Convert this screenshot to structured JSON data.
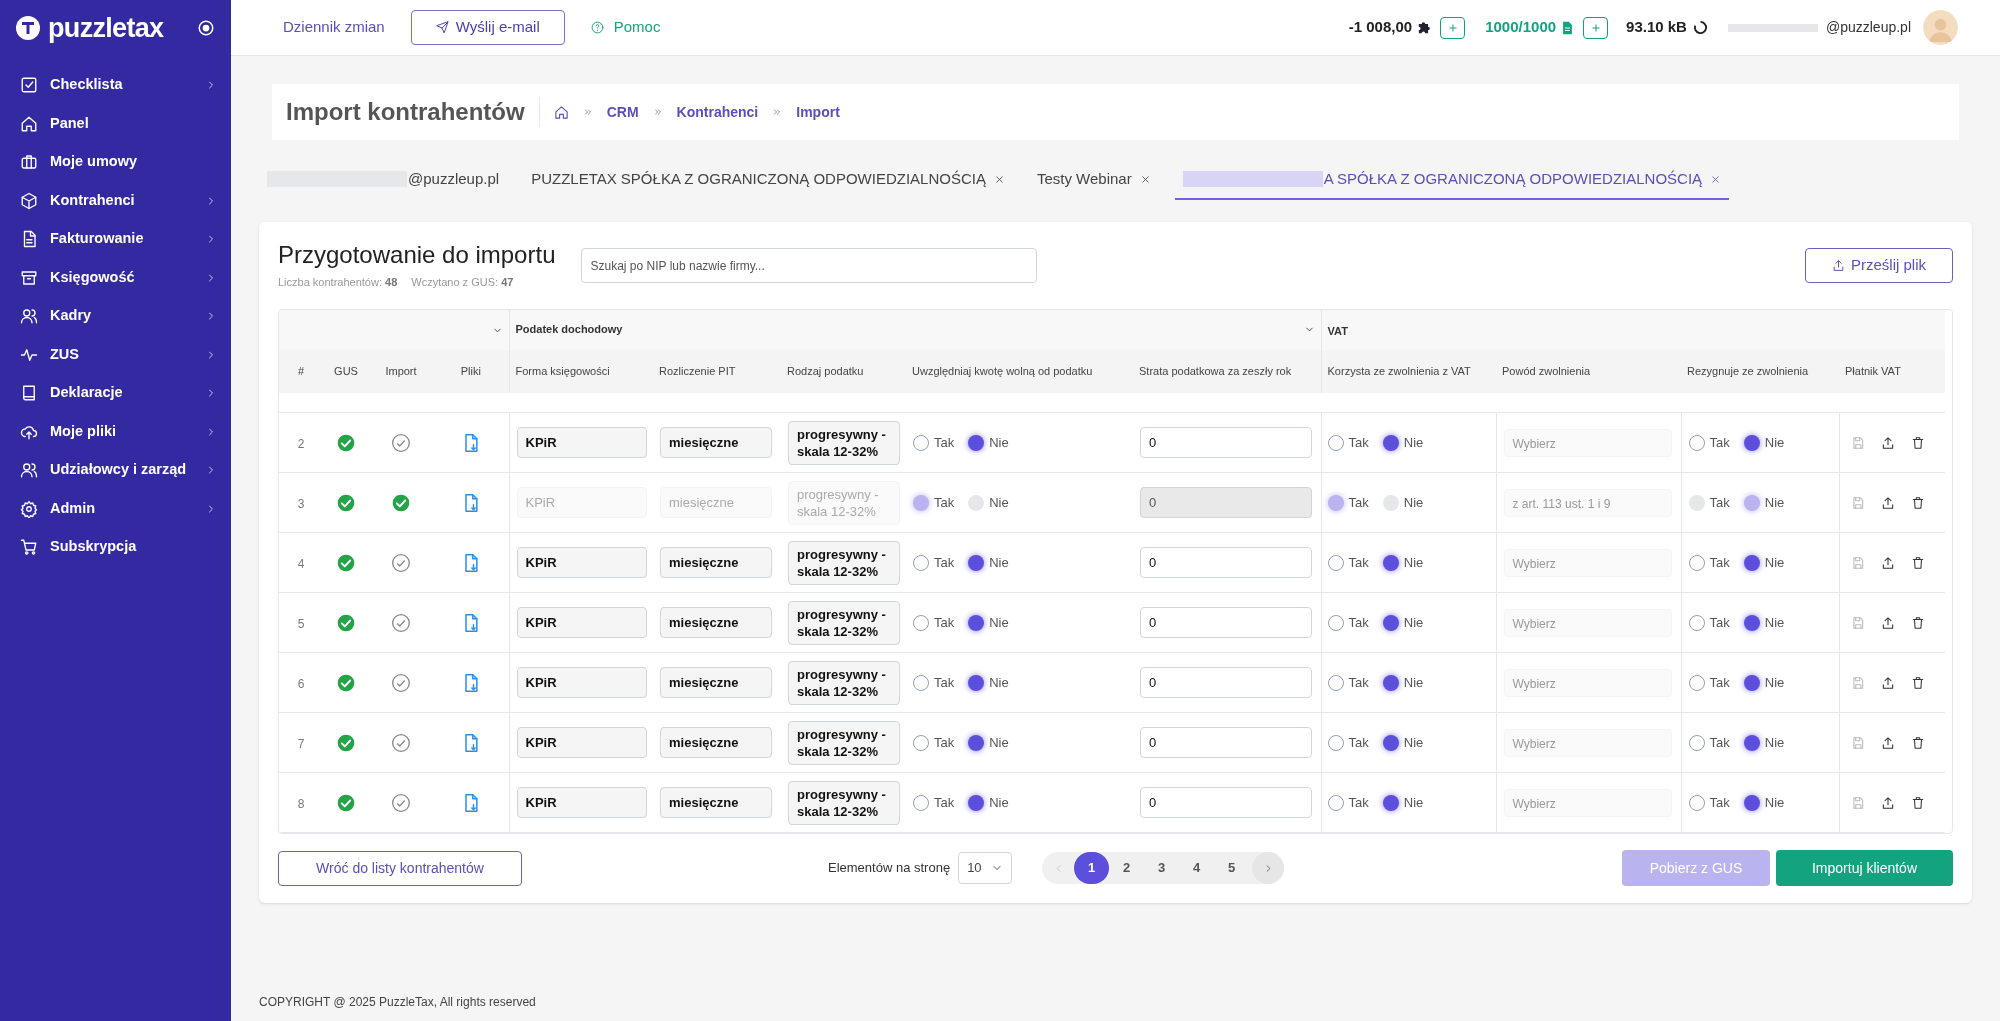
{
  "sidebar": {
    "logo": "puzzletax",
    "items": [
      {
        "label": "Checklista",
        "submenu": true
      },
      {
        "label": "Panel",
        "submenu": false
      },
      {
        "label": "Moje umowy",
        "submenu": false
      },
      {
        "label": "Kontrahenci",
        "submenu": true
      },
      {
        "label": "Fakturowanie",
        "submenu": true
      },
      {
        "label": "Księgowość",
        "submenu": true
      },
      {
        "label": "Kadry",
        "submenu": true
      },
      {
        "label": "ZUS",
        "submenu": true
      },
      {
        "label": "Deklaracje",
        "submenu": true
      },
      {
        "label": "Moje pliki",
        "submenu": true
      },
      {
        "label": "Udziałowcy i zarząd",
        "submenu": true
      },
      {
        "label": "Admin",
        "submenu": true
      },
      {
        "label": "Subskrypcja",
        "submenu": false
      }
    ]
  },
  "topbar": {
    "changelog": "Dziennik zmian",
    "email_button": "Wyślij e-mail",
    "help": "Pomoc",
    "balance": "-1 008,00",
    "documents": "1000/1000",
    "storage": "93.10 kB",
    "user_email": "@puzzleup.pl"
  },
  "header": {
    "title": "Import kontrahentów",
    "breadcrumb": [
      "CRM",
      "Kontrahenci",
      "Import"
    ]
  },
  "tabs": [
    {
      "label": "@puzzleup.pl",
      "selected": false,
      "redacted": true,
      "closable": false
    },
    {
      "label": "PUZZLETAX SPÓŁKA Z OGRANICZONĄ ODPOWIEDZIALNOŚCIĄ",
      "selected": false,
      "redacted": false,
      "closable": true
    },
    {
      "label": "Testy Webinar",
      "selected": false,
      "redacted": false,
      "closable": true
    },
    {
      "label": "A SPÓŁKA Z OGRANICZONĄ ODPOWIEDZIALNOŚCIĄ",
      "selected": true,
      "redacted": true,
      "closable": true
    }
  ],
  "card": {
    "title": "Przygotowanie do importu",
    "stats": [
      {
        "label": "Liczba kontrahentów:",
        "value": "48"
      },
      {
        "label": "Wczytano z GUS:",
        "value": "47"
      }
    ],
    "search": {
      "placeholder": "Szukaj po NIP lub nazwie firmy..."
    },
    "upload_button": "Prześlij plik"
  },
  "table": {
    "groups": [
      "Podatek dochodowy",
      "VAT"
    ],
    "columns": [
      "#",
      "GUS",
      "Import",
      "Pliki",
      "Forma księgowości",
      "Rozliczenie PIT",
      "Rodzaj podatku",
      "Uwzględniaj kwotę wolną od podatku",
      "Strata podatkowa za zeszły rok",
      "Korzysta ze zwolnienia z VAT",
      "Powód zwolnienia",
      "Rezygnuje ze zwolnienia",
      "Płatnik VAT"
    ],
    "rows": [
      {
        "number": "2",
        "gus": true,
        "imported": false,
        "accounting": "KPiR",
        "pit": "miesięczne",
        "tax_type": "progresywny - skala 12-32%",
        "free_amount": [
          {
            "label": "Tak",
            "selected": false
          },
          {
            "label": "Nie",
            "selected": true
          }
        ],
        "loss": "0",
        "vat_exempt": [
          {
            "label": "Tak",
            "selected": false
          },
          {
            "label": "Nie",
            "selected": true
          }
        ],
        "reason": {
          "placeholder": "Wybierz"
        },
        "resign": [
          {
            "label": "Tak",
            "selected": false
          },
          {
            "label": "Nie",
            "selected": true
          }
        ]
      },
      {
        "number": "3",
        "gus": true,
        "imported": true,
        "accounting": "KPiR",
        "pit": "miesięczne",
        "tax_type": "progresywny - skala 12-32%",
        "free_amount": [
          {
            "label": "Tak",
            "selected": true
          },
          {
            "label": "Nie",
            "selected": false
          }
        ],
        "loss": "0",
        "vat_exempt": [
          {
            "label": "Tak",
            "selected": true
          },
          {
            "label": "Nie",
            "selected": false
          }
        ],
        "reason": {
          "value": "z art. 113 ust. 1 i 9"
        },
        "resign": [
          {
            "label": "Tak",
            "selected": false
          },
          {
            "label": "Nie",
            "selected": true
          }
        ]
      },
      {
        "number": "4",
        "gus": true,
        "imported": false,
        "accounting": "KPiR",
        "pit": "miesięczne",
        "tax_type": "progresywny - skala 12-32%",
        "free_amount": [
          {
            "label": "Tak",
            "selected": false
          },
          {
            "label": "Nie",
            "selected": true
          }
        ],
        "loss": "0",
        "vat_exempt": [
          {
            "label": "Tak",
            "selected": false
          },
          {
            "label": "Nie",
            "selected": true
          }
        ],
        "reason": {
          "placeholder": "Wybierz"
        },
        "resign": [
          {
            "label": "Tak",
            "selected": false
          },
          {
            "label": "Nie",
            "selected": true
          }
        ]
      },
      {
        "number": "5",
        "gus": true,
        "imported": false,
        "accounting": "KPiR",
        "pit": "miesięczne",
        "tax_type": "progresywny - skala 12-32%",
        "free_amount": [
          {
            "label": "Tak",
            "selected": false
          },
          {
            "label": "Nie",
            "selected": true
          }
        ],
        "loss": "0",
        "vat_exempt": [
          {
            "label": "Tak",
            "selected": false
          },
          {
            "label": "Nie",
            "selected": true
          }
        ],
        "reason": {
          "placeholder": "Wybierz"
        },
        "resign": [
          {
            "label": "Tak",
            "selected": false
          },
          {
            "label": "Nie",
            "selected": true
          }
        ]
      },
      {
        "number": "6",
        "gus": true,
        "imported": false,
        "accounting": "KPiR",
        "pit": "miesięczne",
        "tax_type": "progresywny - skala 12-32%",
        "free_amount": [
          {
            "label": "Tak",
            "selected": false
          },
          {
            "label": "Nie",
            "selected": true
          }
        ],
        "loss": "0",
        "vat_exempt": [
          {
            "label": "Tak",
            "selected": false
          },
          {
            "label": "Nie",
            "selected": true
          }
        ],
        "reason": {
          "placeholder": "Wybierz"
        },
        "resign": [
          {
            "label": "Tak",
            "selected": false
          },
          {
            "label": "Nie",
            "selected": true
          }
        ]
      },
      {
        "number": "7",
        "gus": true,
        "imported": false,
        "accounting": "KPiR",
        "pit": "miesięczne",
        "tax_type": "progresywny - skala 12-32%",
        "free_amount": [
          {
            "label": "Tak",
            "selected": false
          },
          {
            "label": "Nie",
            "selected": true
          }
        ],
        "loss": "0",
        "vat_exempt": [
          {
            "label": "Tak",
            "selected": false
          },
          {
            "label": "Nie",
            "selected": true
          }
        ],
        "reason": {
          "placeholder": "Wybierz"
        },
        "resign": [
          {
            "label": "Tak",
            "selected": false
          },
          {
            "label": "Nie",
            "selected": true
          }
        ]
      },
      {
        "number": "8",
        "gus": true,
        "imported": false,
        "accounting": "KPiR",
        "pit": "miesięczne",
        "tax_type": "progresywny - skala 12-32%",
        "free_amount": [
          {
            "label": "Tak",
            "selected": false
          },
          {
            "label": "Nie",
            "selected": true
          }
        ],
        "loss": "0",
        "vat_exempt": [
          {
            "label": "Tak",
            "selected": false
          },
          {
            "label": "Nie",
            "selected": true
          }
        ],
        "reason": {
          "placeholder": "Wybierz"
        },
        "resign": [
          {
            "label": "Tak",
            "selected": false
          },
          {
            "label": "Nie",
            "selected": true
          }
        ]
      }
    ]
  },
  "footer": {
    "back_button": "Wróć do listy kontrahentów",
    "page_size_label": "Elementów na stronę",
    "page_size": "10",
    "pages": [
      {
        "label": "1",
        "selected": true
      },
      {
        "label": "2",
        "selected": false
      },
      {
        "label": "3",
        "selected": false
      },
      {
        "label": "4",
        "selected": false
      },
      {
        "label": "5",
        "selected": false
      }
    ],
    "gus_button": {
      "label": "Pobierz z GUS",
      "disabled": true
    },
    "import_button": {
      "label": "Importuj klientów",
      "disabled": false
    }
  },
  "copyright": "COPYRIGHT @ 2025 PuzzleTax, All rights reserved"
}
